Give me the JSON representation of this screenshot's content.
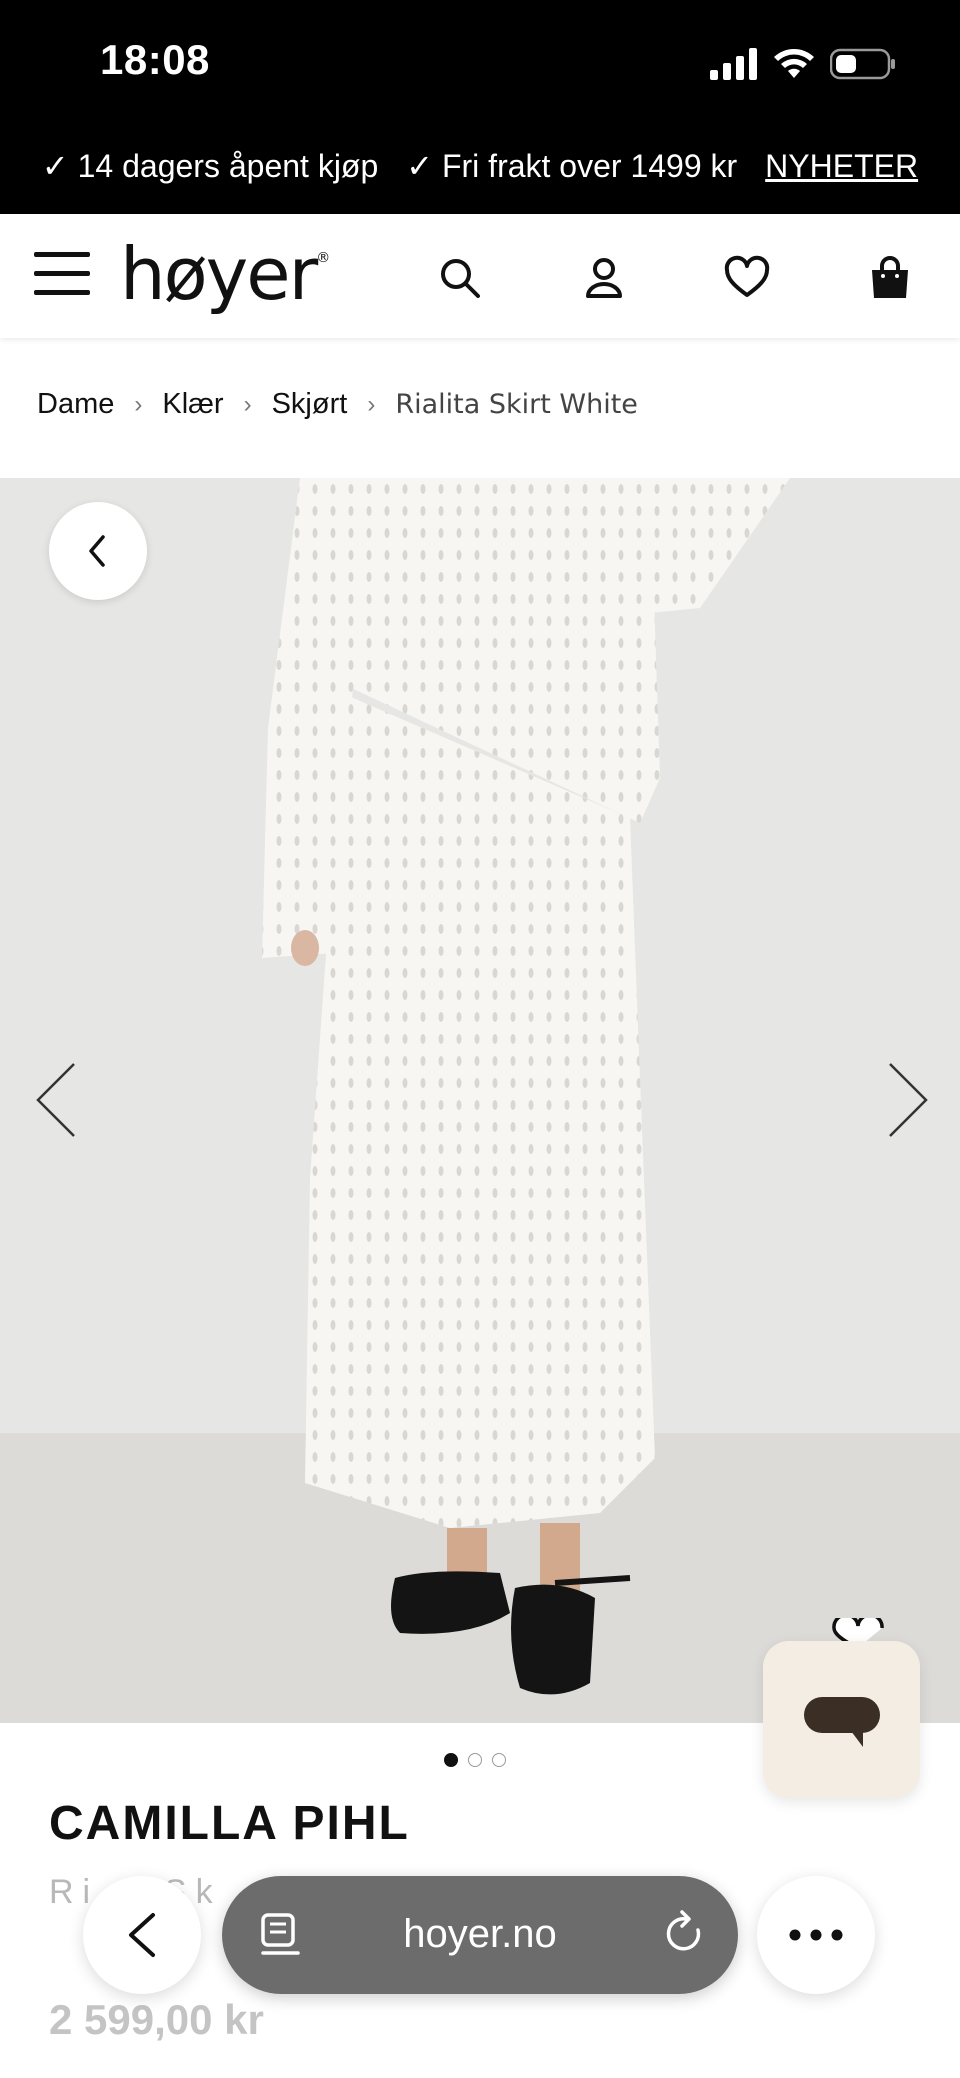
{
  "status_bar": {
    "time": "18:08"
  },
  "promo": {
    "item1": "✓ 14 dagers åpent kjøp",
    "item2": "✓ Fri frakt over 1499 kr",
    "link": "NYHETER"
  },
  "header": {
    "logo": "høyer",
    "logo_mark": "®",
    "icons": [
      "menu-icon",
      "search-icon",
      "user-icon",
      "heart-icon",
      "bag-icon"
    ]
  },
  "breadcrumb": {
    "items": [
      "Dame",
      "Klær",
      "Skjørt"
    ],
    "separator": "›",
    "current": "Rialita Skirt White"
  },
  "gallery": {
    "image_count": 3,
    "active_index": 0,
    "background_color": "#e6e6e5"
  },
  "product": {
    "brand": "CAMILLA PIHL",
    "name": "Rialita Skirt White",
    "name_visible": "Ri    a Sk",
    "price": "2 599,00 kr"
  },
  "safari": {
    "url": "hoyer.no"
  },
  "colors": {
    "promo_bg": "#000000",
    "chat_bg": "#f3ede4",
    "chat_icon": "#3a2e25"
  }
}
